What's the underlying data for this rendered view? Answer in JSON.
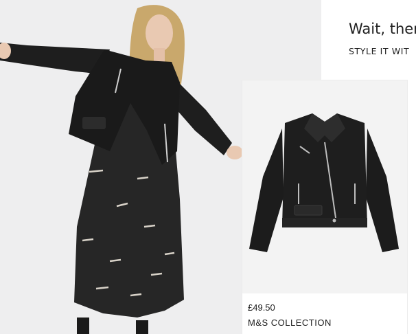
{
  "heading": "Wait, ther",
  "subheading": "STYLE IT WIT",
  "hero": {
    "image": "model-leather-jacket-photo"
  },
  "product": {
    "image": "black-leather-biker-jacket",
    "price": "£49.50",
    "brand": "M&S COLLECTION"
  }
}
